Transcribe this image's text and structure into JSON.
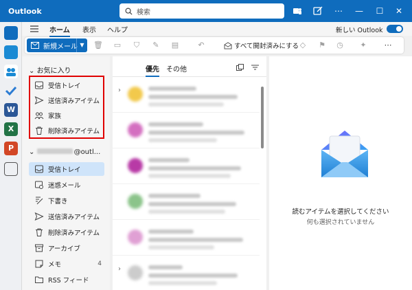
{
  "titlebar": {
    "app_name": "Outlook",
    "search_placeholder": "検索"
  },
  "ribbon": {
    "tabs": [
      {
        "label": "ホーム"
      },
      {
        "label": "表示"
      },
      {
        "label": "ヘルプ"
      }
    ],
    "new_outlook_label": "新しい Outlook",
    "new_mail_label": "新規メール",
    "mark_all_read_label": "すべて開封済みにする"
  },
  "folders": {
    "favorites_header": "お気に入り",
    "favorites": [
      {
        "label": "受信トレイ",
        "icon": "inbox-icon"
      },
      {
        "label": "送信済みアイテム",
        "icon": "send-icon"
      },
      {
        "label": "家族",
        "icon": "people-icon"
      },
      {
        "label": "削除済みアイテム",
        "icon": "trash-icon"
      }
    ],
    "account_suffix": "@outl...",
    "account_items": [
      {
        "label": "受信トレイ",
        "icon": "inbox-icon",
        "count": ""
      },
      {
        "label": "迷惑メール",
        "icon": "junk-icon",
        "count": ""
      },
      {
        "label": "下書き",
        "icon": "draft-icon",
        "count": ""
      },
      {
        "label": "送信済みアイテム",
        "icon": "send-icon",
        "count": ""
      },
      {
        "label": "削除済みアイテム",
        "icon": "trash-icon",
        "count": ""
      },
      {
        "label": "アーカイブ",
        "icon": "archive-icon",
        "count": ""
      },
      {
        "label": "メモ",
        "icon": "note-icon",
        "count": "4"
      },
      {
        "label": "RSS フィード",
        "icon": "folder-icon",
        "count": ""
      }
    ]
  },
  "message_list": {
    "tabs": [
      {
        "label": "優先"
      },
      {
        "label": "その他"
      }
    ]
  },
  "reading_pane": {
    "empty_title": "読むアイテムを選択してください",
    "empty_subtitle": "何も選択されていません"
  },
  "colors": {
    "accent": "#0f6cbd",
    "highlight_border": "#e00000",
    "selected_bg": "#cfe4fa"
  }
}
